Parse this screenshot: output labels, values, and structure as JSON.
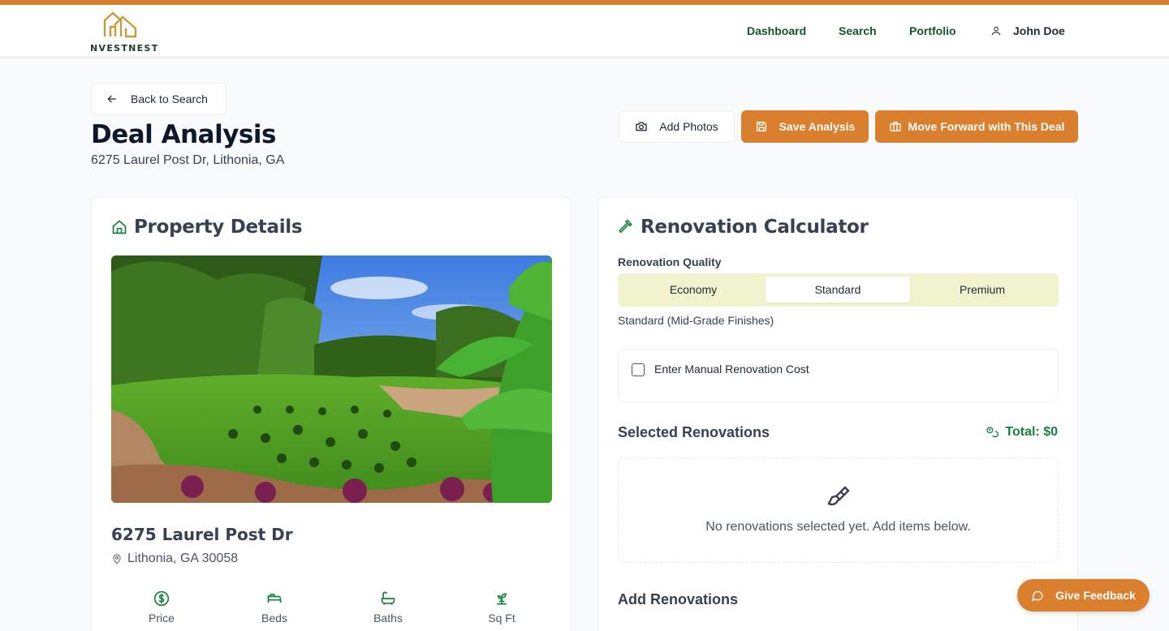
{
  "brand": {
    "name": "NVESTNEST",
    "accent_color": "#d97f2e",
    "brand_green": "#15803d"
  },
  "nav": {
    "links": [
      "Dashboard",
      "Search",
      "Portfolio"
    ],
    "user": {
      "name": "John Doe",
      "icon": "user-icon"
    }
  },
  "header": {
    "back_label": "Back to Search",
    "title": "Deal Analysis",
    "subtitle": "6275 Laurel Post Dr, Lithonia, GA",
    "actions": {
      "add_photos": "Add Photos",
      "save_analysis": "Save Analysis",
      "move_forward": "Move Forward with This Deal"
    }
  },
  "property": {
    "section_title": "Property Details",
    "name": "6275 Laurel Post Dr",
    "location": "Lithonia, GA 30058",
    "stats": [
      {
        "label": "Price",
        "icon": "dollar-icon"
      },
      {
        "label": "Beds",
        "icon": "bed-icon"
      },
      {
        "label": "Baths",
        "icon": "bath-icon"
      },
      {
        "label": "Sq Ft",
        "icon": "sprout-icon"
      }
    ]
  },
  "renovation": {
    "section_title": "Renovation Calculator",
    "quality_label": "Renovation Quality",
    "options": [
      "Economy",
      "Standard",
      "Premium"
    ],
    "selected_option": "Standard",
    "quality_description": "Standard (Mid-Grade Finishes)",
    "manual_label": "Enter Manual Renovation Cost",
    "manual_checked": false,
    "selected_title": "Selected Renovations",
    "total_label": "Total: $0",
    "empty_text": "No renovations selected yet. Add items below.",
    "add_title": "Add Renovations"
  },
  "feedback": {
    "label": "Give Feedback"
  }
}
